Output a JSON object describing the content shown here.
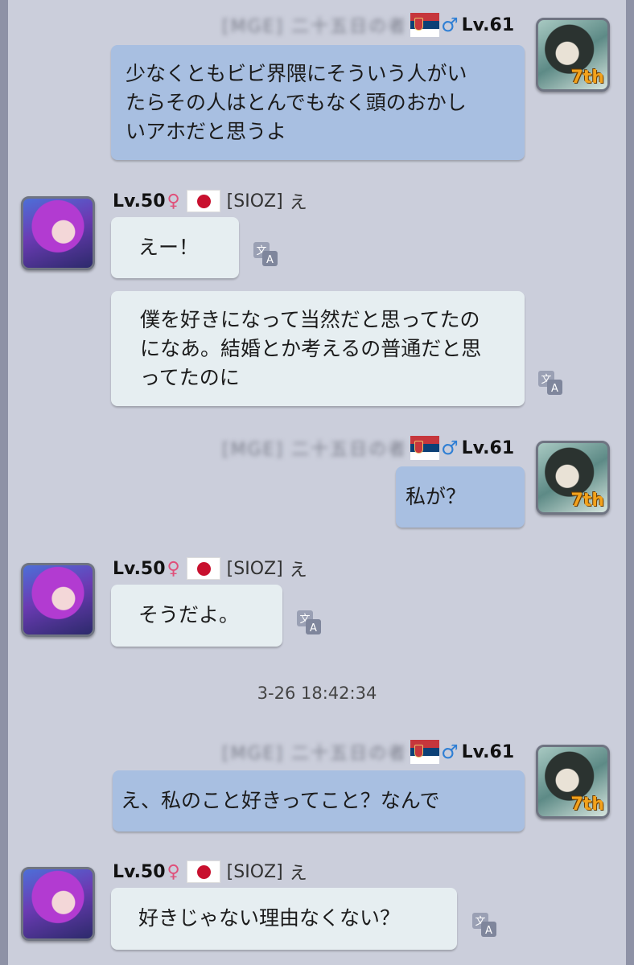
{
  "messages": [
    {
      "side": "out",
      "header": {
        "blurred_name": "[MGE] 二十五日の者",
        "level": "Lv.61",
        "sex": "♂"
      },
      "avatar_badge": "7th",
      "lines": [
        "少なくともビビ界隈にそういう人がい",
        "たらその人はとんでもなく頭のおかし",
        "いアホだと思うよ"
      ]
    },
    {
      "side": "in",
      "header": {
        "level": "Lv.50",
        "sex": "♀",
        "guild": "[SIOZ]",
        "name": "え"
      },
      "lines": [
        "えー！"
      ]
    },
    {
      "side": "in",
      "lines": [
        "僕を好きになって当然だと思ってたの",
        "になあ。結婚とか考えるの普通だと思",
        "ってたのに"
      ]
    },
    {
      "side": "out",
      "header": {
        "blurred_name": "[MGE] 二十五日の者",
        "level": "Lv.61",
        "sex": "♂"
      },
      "avatar_badge": "7th",
      "lines": [
        "私が？"
      ]
    },
    {
      "side": "in",
      "header": {
        "level": "Lv.50",
        "sex": "♀",
        "guild": "[SIOZ]",
        "name": "え"
      },
      "lines": [
        "そうだよ。"
      ]
    },
    {
      "side": "out",
      "header": {
        "blurred_name": "[MGE] 二十五日の者",
        "level": "Lv.61",
        "sex": "♂"
      },
      "avatar_badge": "7th",
      "lines": [
        "え、私のこと好きってこと？なんで"
      ]
    },
    {
      "side": "in",
      "header": {
        "level": "Lv.50",
        "sex": "♀",
        "guild": "[SIOZ]",
        "name": "え"
      },
      "lines": [
        "好きじゃない理由なくない？"
      ]
    }
  ],
  "timestamp": "3-26 18:42:34",
  "icons": {
    "translate": "translate-icon",
    "flag_jp": "flag-japan-icon",
    "flag_rs": "flag-serbia-icon"
  },
  "colors": {
    "out_bubble": "#a8bfe1",
    "in_bubble": "#e6eef1",
    "background": "#cbcedb"
  }
}
